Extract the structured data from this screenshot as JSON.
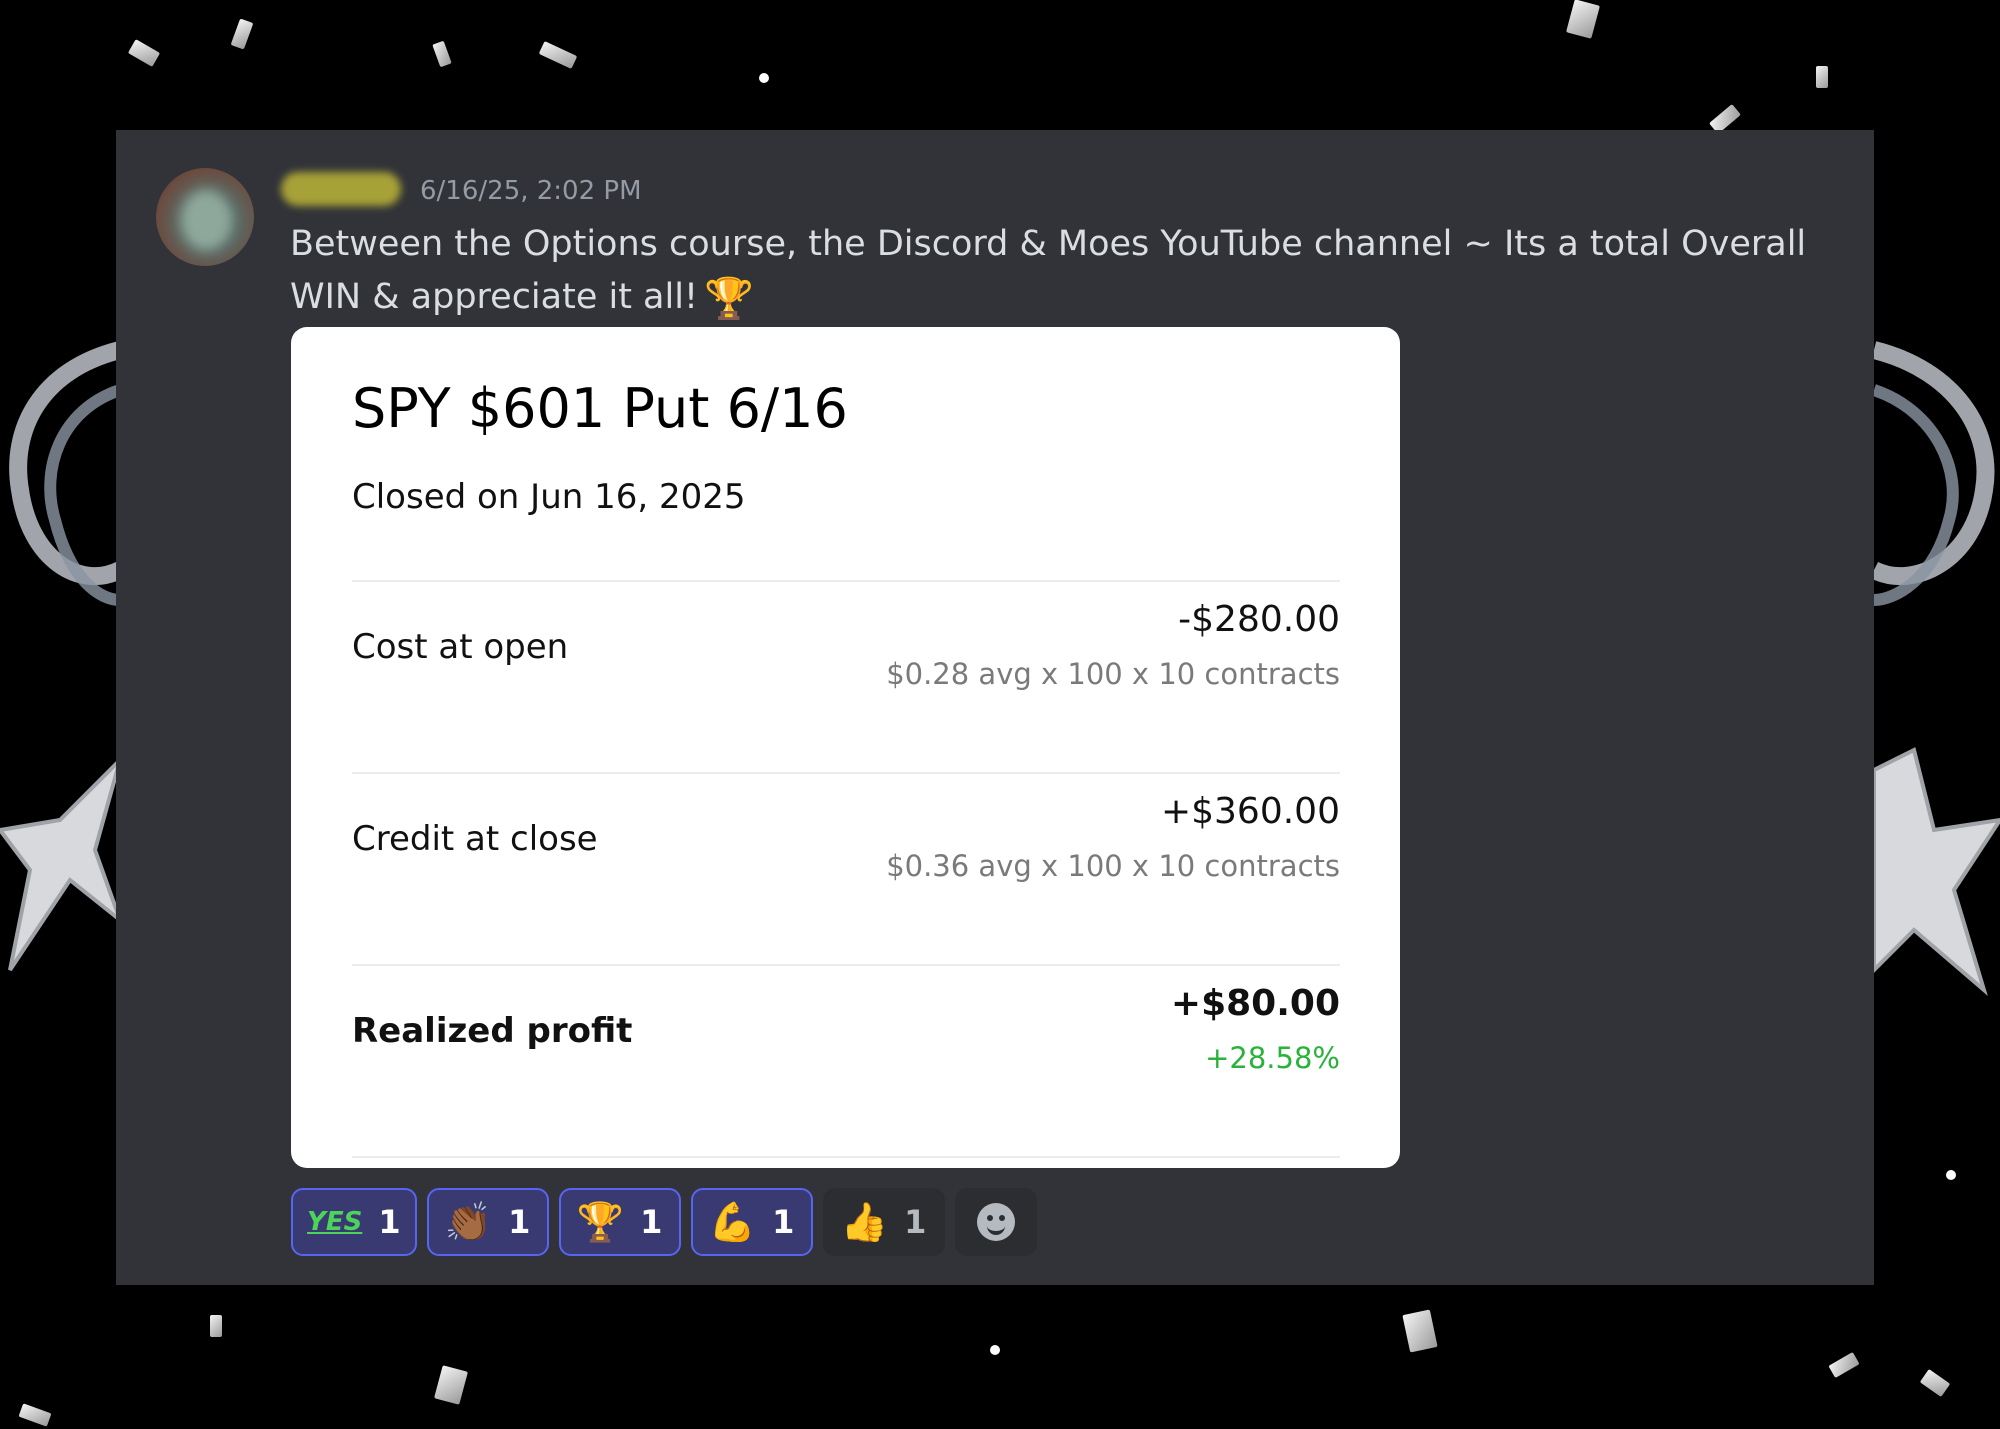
{
  "message": {
    "timestamp": "6/16/25, 2:02 PM",
    "text": "Between the Options course, the Discord & Moes YouTube channel ~ Its a total Overall WIN & appreciate it all!",
    "trailing_emoji": "🏆"
  },
  "card": {
    "title": "SPY $601 Put 6/16",
    "subtitle": "Closed on Jun 16, 2025",
    "rows": [
      {
        "label": "Cost at open",
        "value": "-$280.00",
        "detail": "$0.28 avg x 100 x 10 contracts"
      },
      {
        "label": "Credit at close",
        "value": "+$360.00",
        "detail": "$0.36 avg x 100 x 10 contracts"
      },
      {
        "label": "Realized profit",
        "value": "+$80.00",
        "detail": "+28.58%"
      }
    ]
  },
  "reactions": [
    {
      "emoji": "YES",
      "count": "1"
    },
    {
      "emoji": "👏🏾",
      "count": "1"
    },
    {
      "emoji": "🏆",
      "count": "1"
    },
    {
      "emoji": "💪",
      "count": "1"
    },
    {
      "emoji": "👍",
      "count": "1"
    }
  ],
  "colors": {
    "panel_bg": "#313338",
    "accent": "#5865f2",
    "profit_green": "#29b33a"
  }
}
